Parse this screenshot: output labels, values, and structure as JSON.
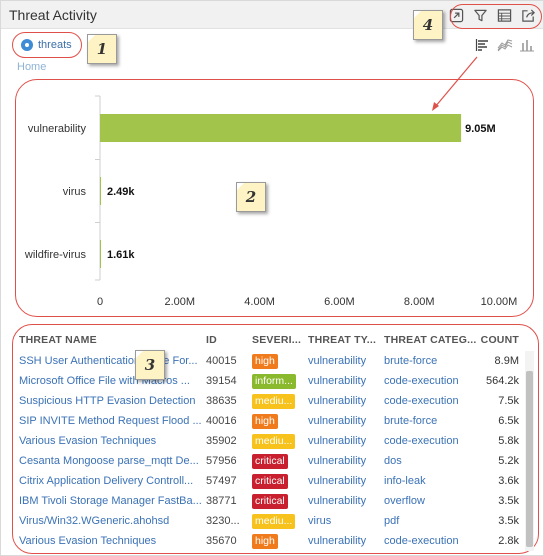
{
  "window": {
    "title": "Threat Activity"
  },
  "colors": {
    "bar": "#a3c44b",
    "link": "#3b72b6",
    "callout_red": "#e0504a",
    "sev_high": "#f07b1d",
    "sev_critical": "#c8202e",
    "sev_medium": "#f6c21b",
    "sev_informational": "#8ab92d"
  },
  "toolbar_icons": [
    {
      "name": "jump-icon"
    },
    {
      "name": "filter-icon"
    },
    {
      "name": "table-icon"
    },
    {
      "name": "export-icon"
    }
  ],
  "radio": {
    "label": "threats",
    "selected": true
  },
  "breadcrumb": {
    "home": "Home"
  },
  "view_icons": [
    "bar-chart-horizontal-icon",
    "area-chart-icon",
    "column-chart-icon"
  ],
  "callouts": [
    "1",
    "2",
    "3",
    "4"
  ],
  "chart_data": {
    "type": "bar",
    "orientation": "horizontal",
    "categories": [
      "vulnerability",
      "virus",
      "wildfire-virus"
    ],
    "values": [
      9050000,
      2490,
      1610
    ],
    "value_labels": [
      "9.05M",
      "2.49k",
      "1.61k"
    ],
    "xlim": [
      0,
      10000000
    ],
    "x_ticks": [
      0,
      2000000,
      4000000,
      6000000,
      8000000,
      10000000
    ],
    "x_tick_labels": [
      "0",
      "2.00M",
      "4.00M",
      "6.00M",
      "8.00M",
      "10.00M"
    ],
    "grid": false
  },
  "table": {
    "columns": [
      "THREAT NAME",
      "ID",
      "SEVERI...",
      "THREAT TY...",
      "THREAT CATEG...",
      "COUNT"
    ],
    "rows": [
      {
        "name": "SSH User Authentication Brute For...",
        "id": "40015",
        "severity": "high",
        "severity_label": "high",
        "type": "vulnerability",
        "category": "brute-force",
        "count": "8.9M"
      },
      {
        "name": "Microsoft Office File with Macros ...",
        "id": "39154",
        "severity": "informational",
        "severity_label": "inform...",
        "type": "vulnerability",
        "category": "code-execution",
        "count": "564.2k"
      },
      {
        "name": "Suspicious HTTP Evasion Detection",
        "id": "38635",
        "severity": "medium",
        "severity_label": "mediu...",
        "type": "vulnerability",
        "category": "code-execution",
        "count": "7.5k"
      },
      {
        "name": "SIP INVITE Method Request Flood ...",
        "id": "40016",
        "severity": "high",
        "severity_label": "high",
        "type": "vulnerability",
        "category": "brute-force",
        "count": "6.5k"
      },
      {
        "name": "Various Evasion Techniques",
        "id": "35902",
        "severity": "medium",
        "severity_label": "mediu...",
        "type": "vulnerability",
        "category": "code-execution",
        "count": "5.8k"
      },
      {
        "name": "Cesanta Mongoose parse_mqtt De...",
        "id": "57956",
        "severity": "critical",
        "severity_label": "critical",
        "type": "vulnerability",
        "category": "dos",
        "count": "5.2k"
      },
      {
        "name": "Citrix Application Delivery Controll...",
        "id": "57497",
        "severity": "critical",
        "severity_label": "critical",
        "type": "vulnerability",
        "category": "info-leak",
        "count": "3.6k"
      },
      {
        "name": "IBM Tivoli Storage Manager FastBa...",
        "id": "38771",
        "severity": "critical",
        "severity_label": "critical",
        "type": "vulnerability",
        "category": "overflow",
        "count": "3.5k"
      },
      {
        "name": "Virus/Win32.WGeneric.ahohsd",
        "id": "3230...",
        "severity": "medium",
        "severity_label": "mediu...",
        "type": "virus",
        "category": "pdf",
        "count": "3.5k"
      },
      {
        "name": "Various Evasion Techniques",
        "id": "35670",
        "severity": "high",
        "severity_label": "high",
        "type": "vulnerability",
        "category": "code-execution",
        "count": "2.8k"
      }
    ]
  }
}
